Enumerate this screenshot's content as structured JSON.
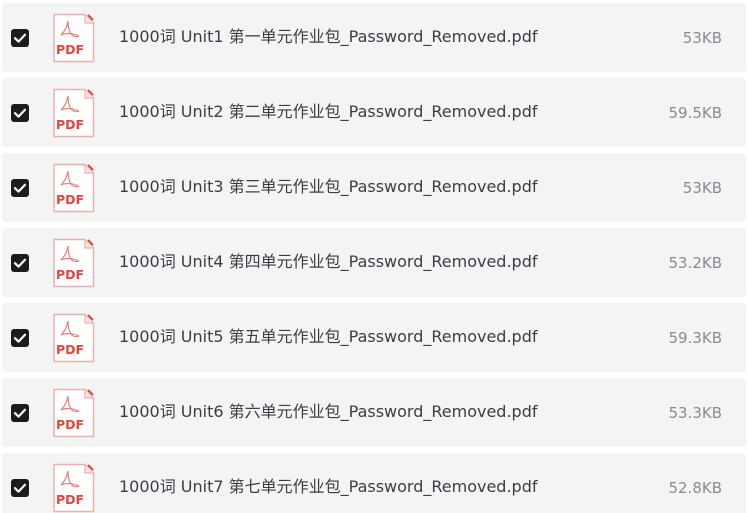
{
  "files": [
    {
      "checked": true,
      "icon": "pdf-icon",
      "icon_text": "PDF",
      "name": "1000词 Unit1 第一单元作业包_Password_Removed.pdf",
      "size": "53KB"
    },
    {
      "checked": true,
      "icon": "pdf-icon",
      "icon_text": "PDF",
      "name": "1000词 Unit2 第二单元作业包_Password_Removed.pdf",
      "size": "59.5KB"
    },
    {
      "checked": true,
      "icon": "pdf-icon",
      "icon_text": "PDF",
      "name": "1000词 Unit3 第三单元作业包_Password_Removed.pdf",
      "size": "53KB"
    },
    {
      "checked": true,
      "icon": "pdf-icon",
      "icon_text": "PDF",
      "name": "1000词 Unit4 第四单元作业包_Password_Removed.pdf",
      "size": "53.2KB"
    },
    {
      "checked": true,
      "icon": "pdf-icon",
      "icon_text": "PDF",
      "name": "1000词 Unit5 第五单元作业包_Password_Removed.pdf",
      "size": "59.3KB"
    },
    {
      "checked": true,
      "icon": "pdf-icon",
      "icon_text": "PDF",
      "name": "1000词 Unit6 第六单元作业包_Password_Removed.pdf",
      "size": "53.3KB"
    },
    {
      "checked": true,
      "icon": "pdf-icon",
      "icon_text": "PDF",
      "name": "1000词 Unit7 第七单元作业包_Password_Removed.pdf",
      "size": "52.8KB"
    }
  ],
  "colors": {
    "row_background": "#f4f4f5",
    "checkbox": "#1c1c1e",
    "pdf_red": "#e0473f",
    "pdf_border": "#e6b3ae",
    "text": "#3c3c44",
    "size_text": "#8a8a93"
  }
}
